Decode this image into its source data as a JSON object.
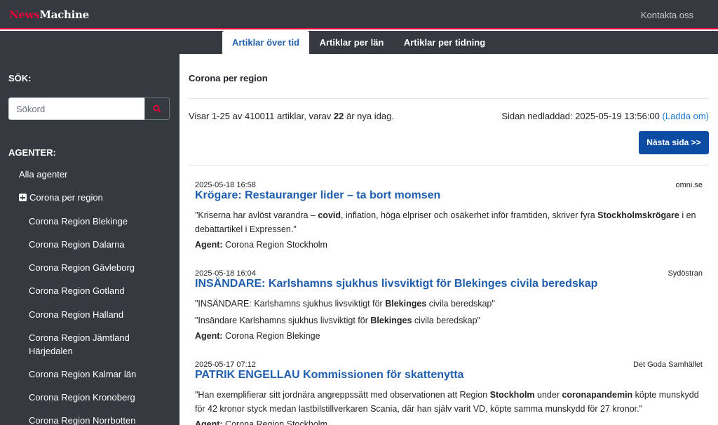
{
  "header": {
    "brand_part1": "News",
    "brand_part2": "Machine",
    "contact": "Kontakta oss"
  },
  "tabs": [
    {
      "label": "Artiklar över tid",
      "active": true
    },
    {
      "label": "Artiklar per län",
      "active": false
    },
    {
      "label": "Artiklar per tidning",
      "active": false
    }
  ],
  "sidebar": {
    "search_heading": "SÖK:",
    "search_placeholder": "Sökord",
    "agents_heading": "AGENTER:",
    "all_agents": "Alla agenter",
    "group": "Corona per region",
    "items": [
      "Corona Region Blekinge",
      "Corona Region Dalarna",
      "Corona Region Gävleborg",
      "Corona Region Gotland",
      "Corona Region Halland",
      "Corona Region Jämtland",
      "Härjedalen",
      "Corona Region Kalmar län",
      "Corona Region Kronoberg",
      "Corona Region Norrbotten"
    ]
  },
  "main": {
    "title": "Corona per region",
    "showing_prefix": "Visar 1-25 av 410011 artiklar, varav ",
    "showing_new": "22",
    "showing_suffix": " är nya idag.",
    "loaded_label": "Sidan nedladdad: 2025-05-19 13:56:00 ",
    "reload": "(Ladda om)",
    "next_button": "Nästa sida  >>"
  },
  "articles": [
    {
      "date": "2025-05-18 16:58",
      "source": "omni.se",
      "title": "Krögare: Restauranger lider – ta bort momsen",
      "quotes": [
        [
          {
            "t": "\"Kriserna har avlöst varandra – ",
            "b": false
          },
          {
            "t": "covid",
            "b": true
          },
          {
            "t": ", inflation, höga elpriser och osäkerhet inför framtiden, skriver fyra ",
            "b": false
          },
          {
            "t": "Stockholmskrögare",
            "b": true
          },
          {
            "t": " i en debattartikel i Expressen.\"",
            "b": false
          }
        ]
      ],
      "agent_label": "Agent:",
      "agent": " Corona Region Stockholm"
    },
    {
      "date": "2025-05-18 16:04",
      "source": "Sydöstran",
      "title": "INSÄNDARE: Karlshamns sjukhus livsviktigt för Blekinges civila beredskap",
      "quotes": [
        [
          {
            "t": "\"INSÄNDARE: Karlshamns sjukhus livsviktigt för ",
            "b": false
          },
          {
            "t": "Blekinges",
            "b": true
          },
          {
            "t": " civila beredskap\"",
            "b": false
          }
        ],
        [
          {
            "t": "\"Insändare Karlshamns sjukhus livsviktigt för ",
            "b": false
          },
          {
            "t": "Blekinges",
            "b": true
          },
          {
            "t": " civila beredskap\"",
            "b": false
          }
        ]
      ],
      "agent_label": "Agent:",
      "agent": " Corona Region Blekinge"
    },
    {
      "date": "2025-05-17 07:12",
      "source": "Det Goda Samhället",
      "title": "PATRIK ENGELLAU Kommissionen för skattenytta",
      "quotes": [
        [
          {
            "t": "\"Han exemplifierar sitt jordnära angreppssätt med observationen att Region ",
            "b": false
          },
          {
            "t": "Stockholm",
            "b": true
          },
          {
            "t": " under ",
            "b": false
          },
          {
            "t": "coronapandemin",
            "b": true
          },
          {
            "t": " köpte munskydd för 42 kronor styck medan lastbilstillverkaren Scania, där han själv varit VD, köpte samma munskydd för 27 kronor.\"",
            "b": false
          }
        ]
      ],
      "agent_label": "Agent:",
      "agent": " Corona Region Stockholm"
    }
  ],
  "colors": {
    "brand_red": "#e4003b",
    "dark_bg": "#343a40",
    "link_blue": "#1f5fae",
    "button_blue": "#0d4ca3"
  }
}
